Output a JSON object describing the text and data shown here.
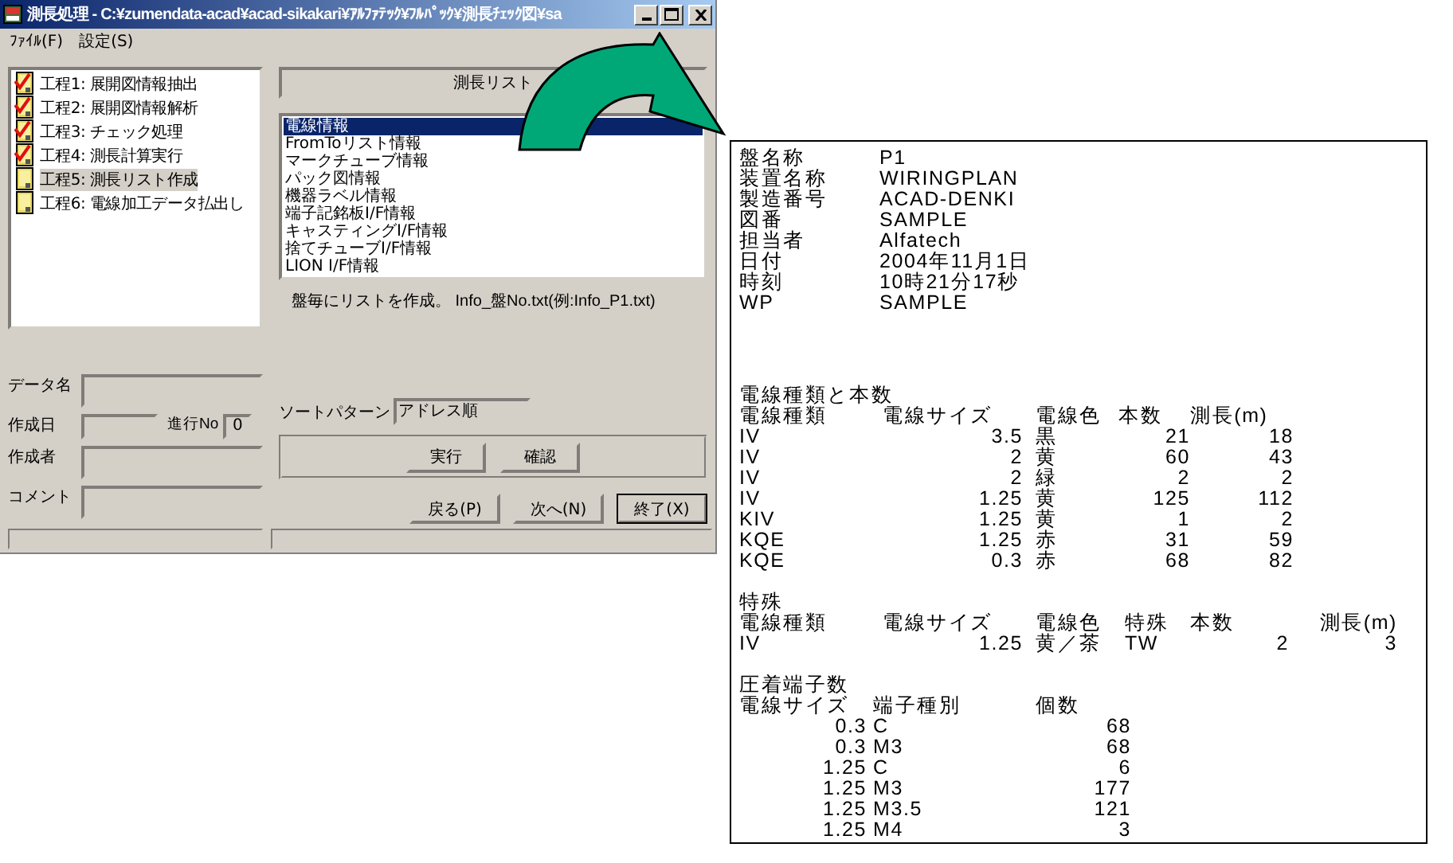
{
  "window": {
    "title": "測長処理 - C:¥zumendata-acad¥acad-sikakari¥ｱﾙﾌｧﾃｯｸ¥ﾌﾙﾊﾟｯｸ¥測長ﾁｪｯｸ図¥sa"
  },
  "menu": [
    "ﾌｧｲﾙ(F)",
    "設定(S)"
  ],
  "steps": [
    {
      "label": "工程1: 展開図情報抽出",
      "checked": true,
      "selected": false
    },
    {
      "label": "工程2: 展開図情報解析",
      "checked": true,
      "selected": false
    },
    {
      "label": "工程3: チェック処理",
      "checked": true,
      "selected": false
    },
    {
      "label": "工程4: 測長計算実行",
      "checked": true,
      "selected": false
    },
    {
      "label": "工程5: 測長リスト作成",
      "checked": false,
      "selected": true
    },
    {
      "label": "工程6: 電線加工データ払出し",
      "checked": false,
      "selected": false
    }
  ],
  "list_header": "測長リスト",
  "list_items": [
    {
      "label": "電線情報",
      "selected": true
    },
    {
      "label": "FromToリスト情報",
      "selected": false
    },
    {
      "label": "マークチューブ情報",
      "selected": false
    },
    {
      "label": "パック図情報",
      "selected": false
    },
    {
      "label": "機器ラベル情報",
      "selected": false
    },
    {
      "label": "端子記銘板I/F情報",
      "selected": false
    },
    {
      "label": "キャスティングI/F情報",
      "selected": false
    },
    {
      "label": "捨てチューブI/F情報",
      "selected": false
    },
    {
      "label": "LION I/F情報",
      "selected": false
    }
  ],
  "note": "盤毎にリストを作成。 Info_盤No.txt(例:Info_P1.txt)",
  "info": {
    "data_name": "データ名",
    "created": "作成日",
    "progress_label": "進行No",
    "progress_value": "0",
    "author": "作成者",
    "comment": "コメント"
  },
  "sort": {
    "label": "ソートパターン",
    "value": "アドレス順"
  },
  "actions": [
    "実行",
    "確認"
  ],
  "nav": [
    {
      "label": "戻る(P)",
      "default": false
    },
    {
      "label": "次へ(N)",
      "default": false
    },
    {
      "label": "終了(X)",
      "default": true
    }
  ],
  "report": {
    "fields": [
      {
        "label": "盤名称",
        "value": "P1"
      },
      {
        "label": "装置名称",
        "value": "WIRINGPLAN"
      },
      {
        "label": "製造番号",
        "value": "ACAD-DENKI"
      },
      {
        "label": "図番",
        "value": "SAMPLE"
      },
      {
        "label": "担当者",
        "value": "Alfatech"
      },
      {
        "label": "日付",
        "value": "2004年11月1日"
      },
      {
        "label": "時刻",
        "value": "10時21分17秒"
      },
      {
        "label": "WP",
        "value": "SAMPLE"
      }
    ],
    "sections": [
      {
        "title": "電線種類と本数",
        "columns": [
          "電線種類",
          "電線サイズ",
          "電線色",
          "本数",
          "測長(m)"
        ],
        "rows": [
          [
            "IV",
            "3.5",
            "黒",
            "21",
            "18"
          ],
          [
            "IV",
            "2",
            "黄",
            "60",
            "43"
          ],
          [
            "IV",
            "2",
            "緑",
            "2",
            "2"
          ],
          [
            "IV",
            "1.25",
            "黄",
            "125",
            "112"
          ],
          [
            "KIV",
            "1.25",
            "黄",
            "1",
            "2"
          ],
          [
            "KQE",
            "1.25",
            "赤",
            "31",
            "59"
          ],
          [
            "KQE",
            "0.3",
            "赤",
            "68",
            "82"
          ]
        ]
      },
      {
        "title": "特殊",
        "columns": [
          "電線種類",
          "電線サイズ",
          "電線色",
          "特殊",
          "本数",
          "測長(m)"
        ],
        "rows": [
          [
            "IV",
            "1.25",
            "黄／茶",
            "TW",
            "2",
            "3"
          ]
        ]
      },
      {
        "title": "圧着端子数",
        "columns": [
          "電線サイズ",
          "端子種別",
          "個数"
        ],
        "rows": [
          [
            "0.3",
            "C",
            "68"
          ],
          [
            "0.3",
            "M3",
            "68"
          ],
          [
            "1.25",
            "C",
            "6"
          ],
          [
            "1.25",
            "M3",
            "177"
          ],
          [
            "1.25",
            "M3.5",
            "121"
          ],
          [
            "1.25",
            "M4",
            "3"
          ]
        ]
      }
    ]
  }
}
